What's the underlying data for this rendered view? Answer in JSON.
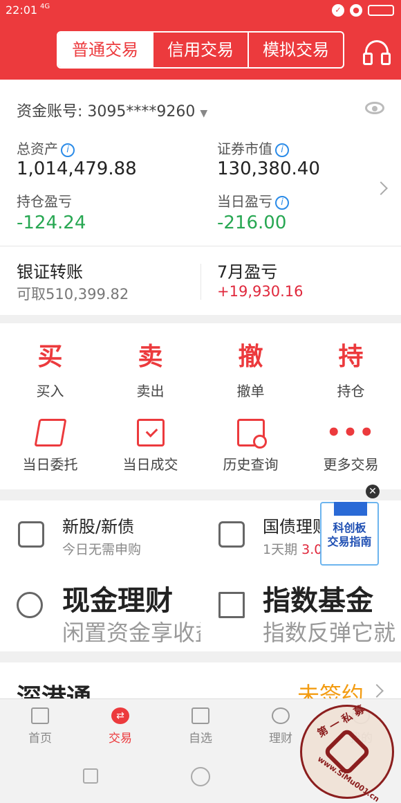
{
  "status_bar": {
    "time": "22:01",
    "network": "4G"
  },
  "header": {
    "tabs": [
      {
        "label": "普通交易"
      },
      {
        "label": "信用交易"
      },
      {
        "label": "模拟交易"
      }
    ],
    "active_tab": "普通交易"
  },
  "account": {
    "label": "资金账号:",
    "number": "3095****9260",
    "total_assets_label": "总资产",
    "total_assets": "1,014,479.88",
    "market_value_label": "证券市值",
    "market_value": "130,380.40",
    "position_pl_label": "持仓盈亏",
    "position_pl": "-124.24",
    "daily_pl_label": "当日盈亏",
    "daily_pl": "-216.00",
    "transfer_title": "银证转账",
    "transfer_sub": "可取510,399.82",
    "monthly_title": "7月盈亏",
    "monthly_value": "+19,930.16"
  },
  "actions": [
    {
      "glyph": "买",
      "label": "买入"
    },
    {
      "glyph": "卖",
      "label": "卖出"
    },
    {
      "glyph": "撤",
      "label": "撤单"
    },
    {
      "glyph": "持",
      "label": "持仓"
    },
    {
      "icon": "entrust-icon",
      "label": "当日委托"
    },
    {
      "icon": "deal-icon",
      "label": "当日成交"
    },
    {
      "icon": "history-icon",
      "label": "历史查询"
    },
    {
      "icon": "more-icon",
      "glyph": "•••",
      "label": "更多交易"
    }
  ],
  "products": {
    "ipo_title": "新股/新债",
    "ipo_sub": "今日无需申购",
    "repo_title": "国债理财",
    "repo_sub": "1天期",
    "repo_rate": "3.0",
    "cash_title": "现金理财",
    "cash_sub": "闲置资金享收益",
    "index_title": "指数基金",
    "index_sub": "指数反弹它就"
  },
  "ad": {
    "line1": "科创板",
    "line2": "交易指南"
  },
  "shgt": {
    "title": "深港通",
    "status": "未签约"
  },
  "tabbar": [
    {
      "label": "首页"
    },
    {
      "label": "交易"
    },
    {
      "label": "自选"
    },
    {
      "label": "理财"
    },
    {
      "label": "我的"
    }
  ],
  "watermark": {
    "text1": "第 一 私 募",
    "text2": "www.SiMu001.cn"
  },
  "colors": {
    "brand_red": "#ec3a3d",
    "loss_green": "#27a752",
    "gain_red": "#e0283c",
    "orange": "#f39c12"
  }
}
